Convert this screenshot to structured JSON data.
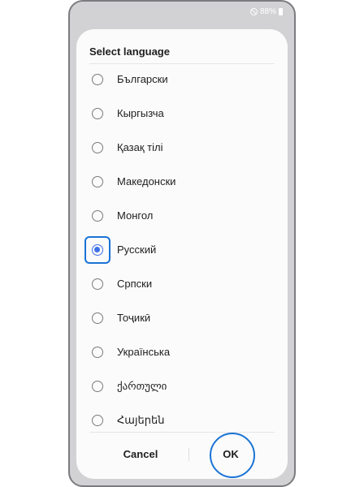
{
  "status_bar": {
    "battery_text": "88%"
  },
  "dialog": {
    "title": "Select language",
    "languages": [
      {
        "label": "Български",
        "selected": false
      },
      {
        "label": "Кыргызча",
        "selected": false
      },
      {
        "label": "Қазақ тілі",
        "selected": false
      },
      {
        "label": "Македонски",
        "selected": false
      },
      {
        "label": "Монгол",
        "selected": false
      },
      {
        "label": "Русский",
        "selected": true
      },
      {
        "label": "Српски",
        "selected": false
      },
      {
        "label": "Тоҷикӣ",
        "selected": false
      },
      {
        "label": "Українська",
        "selected": false
      },
      {
        "label": "ქართული",
        "selected": false
      },
      {
        "label": "Հայերեն",
        "selected": false
      }
    ],
    "cancel_label": "Cancel",
    "ok_label": "OK"
  },
  "colors": {
    "accent": "#3e6ee8",
    "highlight": "#1a73d6"
  }
}
